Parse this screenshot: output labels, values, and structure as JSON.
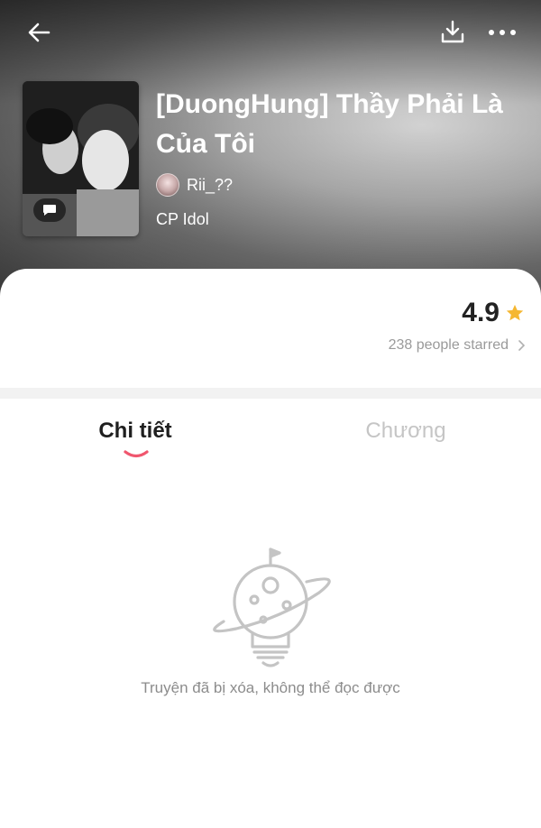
{
  "header": {
    "back_icon": "arrow-left-icon",
    "download_icon": "download-icon",
    "more_icon": "more-dots-icon"
  },
  "story": {
    "title": "[DuongHung] Thầy Phải Là Của Tôi",
    "author": "Rii_??",
    "category": "CP Idol",
    "cover_badge_icon": "comment-bubble-icon"
  },
  "rating": {
    "value": "4.9",
    "starred_text": "238 people starred",
    "star_color": "#F5B731"
  },
  "tabs": [
    {
      "label": "Chi tiết",
      "active": true
    },
    {
      "label": "Chương",
      "active": false
    }
  ],
  "accent_color": "#F0566E",
  "empty_state": {
    "icon": "planet-lightbulb-icon",
    "message": "Truyện đã bị xóa, không thể đọc được"
  }
}
